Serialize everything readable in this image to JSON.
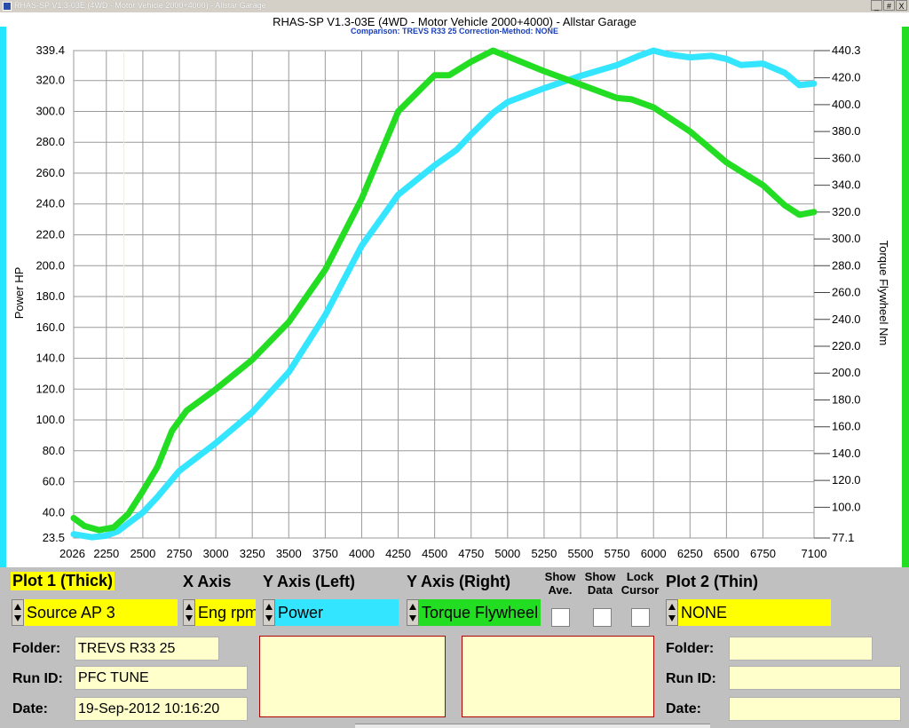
{
  "window": {
    "title": "RHAS-SP V1.3-03E  (4WD - Motor Vehicle 2000+4000) - Allstar Garage",
    "controls": [
      "_",
      "#",
      "X"
    ]
  },
  "header": {
    "title": "RHAS-SP V1.3-03E  (4WD - Motor Vehicle 2000+4000) - Allstar Garage",
    "subtitle": "Comparison: TREVS R33 25     Correction-Method: NONE"
  },
  "colors": {
    "power": "#33e5ff",
    "torque": "#22dd22",
    "grid": "#9a9a9a",
    "cursor": "#ffff66",
    "highlight": "#ffff00",
    "field_bg": "#ffffcc"
  },
  "chart_data": {
    "type": "line",
    "xlabel": "",
    "ylabel_left": "Power HP",
    "ylabel_right": "Torque Flywheel Nm",
    "x_range": [
      2026,
      7100
    ],
    "x_ticks": [
      2026,
      2250,
      2500,
      2750,
      3000,
      3250,
      3500,
      3750,
      4000,
      4250,
      4500,
      4750,
      5000,
      5250,
      5500,
      5750,
      6000,
      6250,
      6500,
      6750,
      7100
    ],
    "y_left_range": [
      23.5,
      339.4
    ],
    "y_left_ticks": [
      23.5,
      40.0,
      60.0,
      80.0,
      100.0,
      120.0,
      140.0,
      160.0,
      180.0,
      200.0,
      220.0,
      240.0,
      260.0,
      280.0,
      300.0,
      320.0,
      339.4
    ],
    "y_right_range": [
      77.1,
      440.3
    ],
    "y_right_ticks": [
      77.1,
      100.0,
      120.0,
      140.0,
      160.0,
      180.0,
      200.0,
      220.0,
      240.0,
      260.0,
      280.0,
      300.0,
      320.0,
      340.0,
      360.0,
      380.0,
      400.0,
      420.0,
      440.3
    ],
    "cursor_x": 2370,
    "grid": true,
    "series": [
      {
        "name": "Power",
        "axis": "left",
        "x": [
          2026,
          2150,
          2250,
          2330,
          2400,
          2500,
          2600,
          2750,
          3000,
          3250,
          3500,
          3750,
          4000,
          4250,
          4500,
          4650,
          4750,
          4900,
          5000,
          5250,
          5500,
          5750,
          5900,
          6000,
          6100,
          6250,
          6400,
          6500,
          6600,
          6750,
          6900,
          7000,
          7100
        ],
        "values": [
          26,
          24,
          25,
          28,
          33,
          40,
          50,
          67,
          85,
          105,
          131,
          168,
          213,
          246,
          265,
          275,
          285,
          299,
          306,
          315,
          323,
          330,
          336,
          339.4,
          337,
          335,
          336,
          334,
          330,
          331,
          325,
          317,
          318
        ]
      },
      {
        "name": "Torque Flywheel",
        "axis": "right",
        "x": [
          2026,
          2100,
          2200,
          2300,
          2400,
          2500,
          2600,
          2700,
          2800,
          3000,
          3250,
          3500,
          3750,
          4000,
          4250,
          4500,
          4600,
          4750,
          4900,
          5000,
          5250,
          5500,
          5750,
          5850,
          6000,
          6250,
          6500,
          6750,
          6900,
          7000,
          7100
        ],
        "values": [
          92,
          86,
          83,
          85,
          95,
          112,
          130,
          157,
          172,
          188,
          210,
          238,
          277,
          330,
          395,
          422,
          422,
          432,
          440.3,
          436,
          425,
          415,
          405,
          404,
          398,
          380,
          357,
          340,
          325,
          318,
          320
        ]
      }
    ]
  },
  "controls": {
    "plot1": {
      "header": "Plot 1 (Thick)",
      "value": "Source AP 3"
    },
    "xaxis": {
      "header": "X Axis",
      "value": "Eng rpm"
    },
    "yleft": {
      "header": "Y Axis (Left)",
      "value": "Power"
    },
    "yright": {
      "header": "Y Axis (Right)",
      "value": "Torque Flywheel"
    },
    "show_ave": "Show\nAve.",
    "show_data": "Show\nData",
    "lock_cursor": "Lock\nCursor",
    "plot2": {
      "header": "Plot 2 (Thin)",
      "value": "NONE"
    }
  },
  "left_info": {
    "folder_label": "Folder:",
    "folder": "TREVS R33 25",
    "run_label": "Run ID:",
    "run": "PFC TUNE",
    "date_label": "Date:",
    "date": "19-Sep-2012  10:16:20"
  },
  "right_info": {
    "folder_label": "Folder:",
    "folder": "",
    "run_label": "Run ID:",
    "run": "",
    "date_label": "Date:",
    "date": ""
  }
}
